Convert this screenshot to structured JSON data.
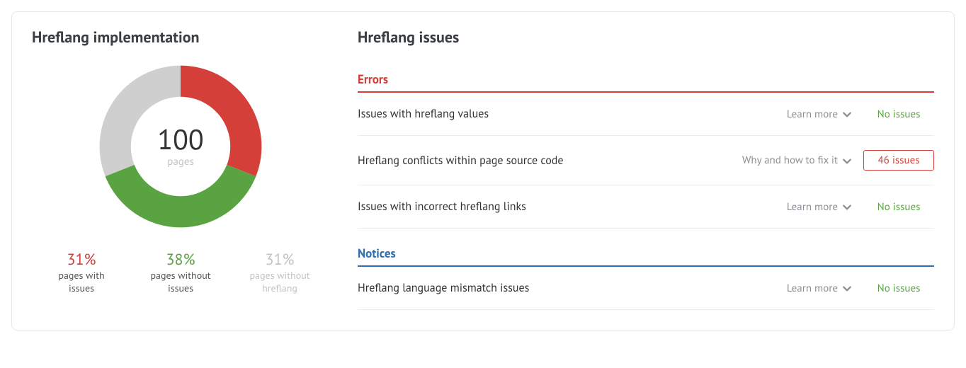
{
  "implementation": {
    "title": "Hreflang implementation",
    "total_value": "100",
    "total_label": "pages",
    "legend": [
      {
        "pct": "31%",
        "label": "pages with\nissues",
        "color": "red"
      },
      {
        "pct": "38%",
        "label": "pages without\nissues",
        "color": "green"
      },
      {
        "pct": "31%",
        "label": "pages without\nhreflang",
        "color": "grey"
      }
    ]
  },
  "issues": {
    "title": "Hreflang issues",
    "sections": [
      {
        "key": "errors",
        "label": "Errors",
        "rows": [
          {
            "name": "Issues with hreflang values",
            "hint": "Learn more",
            "status": "No issues",
            "ok": true
          },
          {
            "name": "Hreflang conflicts within page source code",
            "hint": "Why and how to fix it",
            "status": "46 issues",
            "ok": false
          },
          {
            "name": "Issues with incorrect hreflang links",
            "hint": "Learn more",
            "status": "No issues",
            "ok": true
          }
        ]
      },
      {
        "key": "notices",
        "label": "Notices",
        "rows": [
          {
            "name": "Hreflang language mismatch issues",
            "hint": "Learn more",
            "status": "No issues",
            "ok": true
          }
        ]
      }
    ]
  },
  "chart_data": {
    "type": "pie",
    "title": "Hreflang implementation",
    "categories": [
      "pages with issues",
      "pages without issues",
      "pages without hreflang"
    ],
    "values": [
      31,
      38,
      31
    ],
    "colors": [
      "#d43f3a",
      "#5aa342",
      "#cfcfcf"
    ],
    "total": 100,
    "total_label": "pages"
  }
}
